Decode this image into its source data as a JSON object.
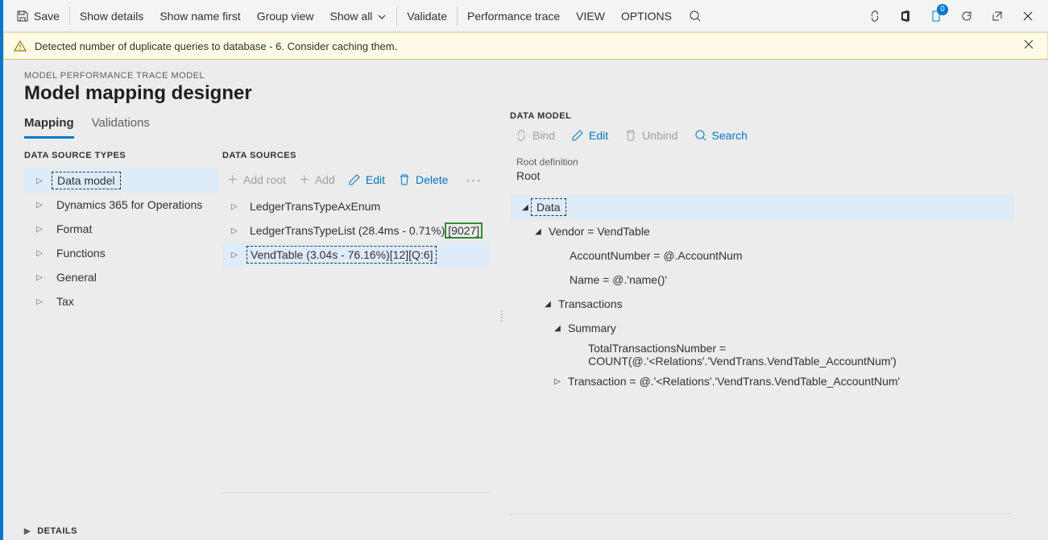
{
  "toolbar": {
    "save": "Save",
    "show_details": "Show details",
    "show_name_first": "Show name first",
    "group_view": "Group view",
    "show_all": "Show all",
    "validate": "Validate",
    "performance_trace": "Performance trace",
    "view": "VIEW",
    "options": "OPTIONS",
    "badge_count": "0"
  },
  "warning": {
    "text": "Detected number of duplicate queries to database - 6. Consider caching them."
  },
  "header": {
    "breadcrumb": "MODEL PERFORMANCE TRACE MODEL",
    "title": "Model mapping designer"
  },
  "tabs": {
    "mapping": "Mapping",
    "validations": "Validations"
  },
  "types": {
    "heading": "DATA SOURCE TYPES",
    "items": [
      "Data model",
      "Dynamics 365 for Operations",
      "Format",
      "Functions",
      "General",
      "Tax"
    ]
  },
  "sources": {
    "heading": "DATA SOURCES",
    "toolbar": {
      "add_root": "Add root",
      "add": "Add",
      "edit": "Edit",
      "delete": "Delete"
    },
    "items": {
      "r0": "LedgerTransTypeAxEnum",
      "r1_a": "LedgerTransTypeList (28.4ms - 0.71%)",
      "r1_b": "[9027]",
      "r2": "VendTable (3.04s - 76.16%)[12][Q:6]"
    }
  },
  "model": {
    "heading": "DATA MODEL",
    "toolbar": {
      "bind": "Bind",
      "edit": "Edit",
      "unbind": "Unbind",
      "search": "Search"
    },
    "root_label": "Root definition",
    "root_value": "Root",
    "nodes": {
      "data": "Data",
      "vendor": "Vendor = VendTable",
      "account": "AccountNumber = @.AccountNum",
      "name": "Name = @.'name()'",
      "transactions": "Transactions",
      "summary": "Summary",
      "total": "TotalTransactionsNumber = COUNT(@.'<Relations'.'VendTrans.VendTable_AccountNum')",
      "transaction": "Transaction = @.'<Relations'.'VendTrans.VendTable_AccountNum'"
    }
  },
  "footer": {
    "details": "DETAILS"
  }
}
